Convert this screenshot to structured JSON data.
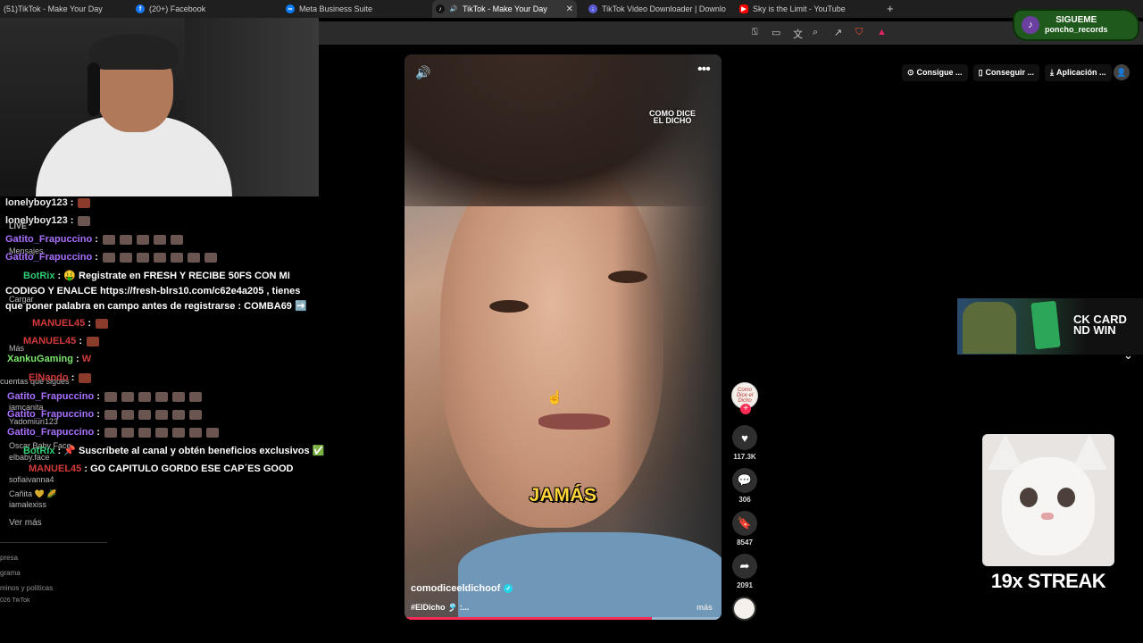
{
  "tabs": [
    {
      "label": "(51)TikTok - Make Your Day",
      "icon": "tiktok-icon",
      "color": "#111111"
    },
    {
      "label": "(20+) Facebook",
      "icon": "facebook-icon",
      "color": "#1877f2"
    },
    {
      "label": "Meta Business Suite",
      "icon": "meta-icon",
      "color": "#0a7cff"
    },
    {
      "label": "TikTok - Make Your Day",
      "icon": "tiktok-icon",
      "color": "#111111",
      "active": true
    },
    {
      "label": "TikTok Video Downloader | Downloa",
      "icon": "download-icon",
      "color": "#5b5bd6"
    },
    {
      "label": "Sky is the Limit - YouTube",
      "icon": "youtube-icon",
      "color": "#ff0000"
    }
  ],
  "new_tab": "+",
  "follow_badge": {
    "line1": "SIGUEME",
    "line2": "poncho_records"
  },
  "chat": {
    "messages": [
      {
        "user": "lonelyboy123",
        "color": "#6b2f2f",
        "text": ""
      },
      {
        "user": "lonelyboy123",
        "color": "#6b2f2f",
        "text": ""
      },
      {
        "user": "Gatito_Frapuccino",
        "color": "#a970ff",
        "text": ""
      },
      {
        "user": "Gatito_Frapuccino",
        "color": "#a970ff",
        "text": ""
      },
      {
        "user": "BotRix",
        "color": "#2ecc71",
        "text": "🤑 Registrate en FRESH Y RECIBE 50FS CON MI CODIGO Y ENALCE https://fresh-blrs10.com/c62e4a205 , tienes que poner palabra en campo antes de registrarse : COMBA69 ➡️"
      },
      {
        "user": "MANUEL45",
        "color": "#d33a3a",
        "text": ""
      },
      {
        "user": "MANUEL45",
        "color": "#d33a3a",
        "text": ""
      },
      {
        "user": "XankuGaming",
        "color": "#7be86b",
        "text": "W"
      },
      {
        "user": "ElNando",
        "color": "#d33a3a",
        "text": ""
      },
      {
        "user": "Gatito_Frapuccino",
        "color": "#a970ff",
        "text": ""
      },
      {
        "user": "Gatito_Frapuccino",
        "color": "#a970ff",
        "text": ""
      },
      {
        "user": "Gatito_Frapuccino",
        "color": "#a970ff",
        "text": ""
      },
      {
        "user": "BotRix",
        "color": "#2ecc71",
        "text": "📌 Suscríbete al canal y obtén beneficios exclusivos ✅"
      },
      {
        "user": "MANUEL45",
        "color": "#d33a3a",
        "text": "GO CAPITULO GORDO ESE CAP´ES GOOD"
      }
    ],
    "separator": ":"
  },
  "sidebar_ghost": {
    "live": "LIVE",
    "messages": "Mensajes",
    "upload": "Cargar",
    "more": "Más",
    "following_accounts": "cuentas que sigues",
    "accounts": [
      "iamcanita",
      "Yadomiuri123",
      "Oscar Baby Face",
      "elbaby.face",
      "sofiaivanna4",
      "Cañita 💛 🌽",
      "iamalexiss"
    ],
    "see_more": "Ver más",
    "footer": [
      "presa",
      "grama",
      "minos y políticas",
      "026 TikTok"
    ]
  },
  "video": {
    "brand_line1": "COMO DICE",
    "brand_line2": "EL DICHO",
    "caption": "JAMÁS",
    "author": "comodiceeldichoof",
    "hashtag": "#ElDicho 🎐 :...",
    "more": "más",
    "progress": 0.78,
    "progress_color": "#fe2c55"
  },
  "actions": {
    "avatar_text": "Como Dice el Dicho",
    "likes": "117.3K",
    "comments": "306",
    "saves": "8547",
    "shares": "2091"
  },
  "header_links": [
    {
      "icon": "coin-icon",
      "label": "Consigue ..."
    },
    {
      "icon": "phone-icon",
      "label": "Conseguir ..."
    },
    {
      "icon": "download-icon",
      "label": "Aplicación ..."
    }
  ],
  "promo": {
    "text_line1": "CK CARD",
    "text_line2": "ND WIN"
  },
  "streak": "19x STREAK"
}
